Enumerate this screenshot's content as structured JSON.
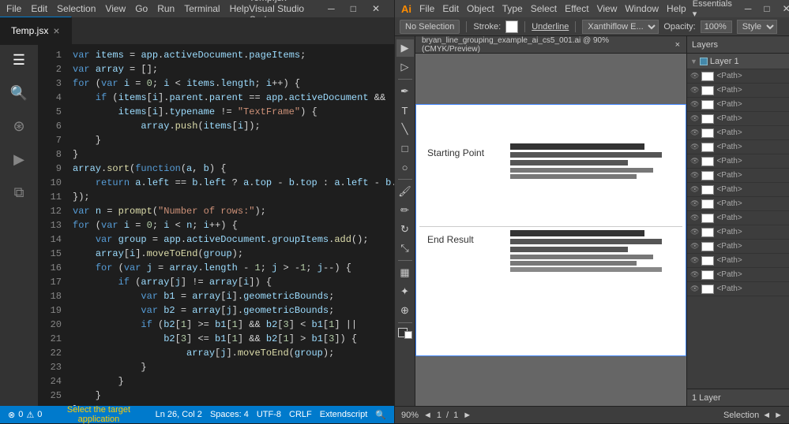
{
  "vscode": {
    "titlebar": {
      "menus": [
        "File",
        "Edit",
        "Selection",
        "View",
        "Go",
        "Run",
        "Terminal",
        "Help"
      ],
      "title": "Temp.jsx - Visual Studio Code",
      "controls": [
        "─",
        "□",
        "✕"
      ]
    },
    "tab": {
      "filename": "Temp.jsx",
      "close": "×"
    },
    "statusbar": {
      "errors": "0",
      "warnings": "0",
      "center_message": "Select the target application",
      "line": "Ln 26, Col 2",
      "spaces": "Spaces: 4",
      "encoding": "UTF-8",
      "line_ending": "CRLF",
      "language": "Extendscript",
      "search_icon": "🔍"
    },
    "code_lines": [
      "var items = app.activeDocument.pageItems;",
      "var array = [];",
      "for (var i = 0; i < items.length; i++) {",
      "    if (items[i].parent.parent == app.activeDocument &&",
      "        items[i].typename != \"TextFrame\") {",
      "            array.push(items[i]);",
      "    }",
      "}",
      "array.sort(function(a, b) {",
      "    return a.left == b.left ? a.top - b.top : a.left - b.left;",
      "});",
      "var n = prompt(\"Number of rows:\");",
      "for (var i = 0; i < n; i++) {",
      "    var group = app.activeDocument.groupItems.add();",
      "    array[i].moveToEnd(group);",
      "    for (var j = array.length - 1; j > -1; j--) {",
      "        if (array[j] != array[i]) {",
      "            var b1 = array[i].geometricBounds;",
      "            var b2 = array[j].geometricBounds;",
      "            if (b2[1] >= b1[1] && b2[3] < b1[1] ||",
      "                b2[3] <= b1[1] && b2[1] > b1[3]) {",
      "                    array[j].moveToEnd(group);",
      "            }",
      "        }",
      "    }",
      "}"
    ]
  },
  "illustrator": {
    "titlebar": {
      "logo": "Ai",
      "menus": [
        "File",
        "Edit",
        "Object",
        "Type",
        "Select",
        "Effect",
        "View",
        "Window",
        "Help"
      ],
      "title": "Essentials ▾"
    },
    "controlbar": {
      "no_selection": "No Selection",
      "stroke_label": "Stroke:",
      "style_label": "Style",
      "opacity_label": "Opacity:",
      "opacity_value": "100%"
    },
    "canvas_tab": {
      "filename": "bryan_line_grouping_example_ai_cs5_001.ai @ 90% (CMYK/Preview)"
    },
    "canvas": {
      "starting_point_label": "Starting Point",
      "end_result_label": "End Result"
    },
    "layers": {
      "header": "Layers",
      "layer_name": "Layer 1",
      "items": [
        "<Path>",
        "<Path>",
        "<Path>",
        "<Path>",
        "<Path>",
        "<Path>",
        "<Path>",
        "<Path>",
        "<Path>",
        "<Path>",
        "<Path>",
        "<Path>",
        "<Path>",
        "<Path>",
        "<Path>",
        "<Path>"
      ],
      "footer_layer": "1 Layer"
    },
    "statusbar": {
      "zoom": "90%",
      "artboard": "1",
      "total_artboards": "1",
      "status": "Selection"
    }
  }
}
